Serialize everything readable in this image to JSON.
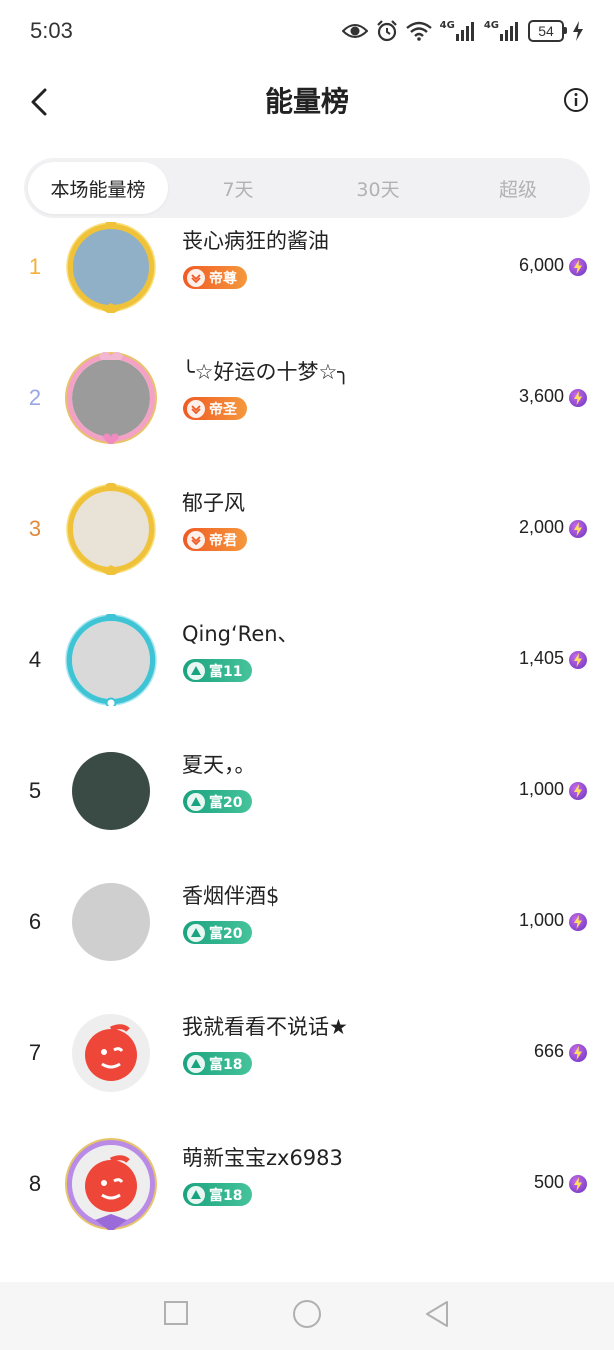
{
  "status_bar": {
    "time": "5:03",
    "battery": "54",
    "net1": "4G",
    "net2": "4G"
  },
  "header": {
    "title": "能量榜"
  },
  "tabs": [
    "本场能量榜",
    "7天",
    "30天",
    "超级"
  ],
  "ranking": [
    {
      "rank": "1",
      "rank_color": "#f3b13a",
      "name": "丧心病狂的酱油",
      "badge": "帝尊",
      "badge_type": "orange",
      "score": "6,000",
      "avatar_bg": "#8fb0c6",
      "frame": "gold"
    },
    {
      "rank": "2",
      "rank_color": "#9aa6e8",
      "name": "╰☆好运の十梦☆╮",
      "badge": "帝圣",
      "badge_type": "orange",
      "score": "3,600",
      "avatar_bg": "#9b9b9b",
      "frame": "pink"
    },
    {
      "rank": "3",
      "rank_color": "#e08a3a",
      "name": "郁子风",
      "badge": "帝君",
      "badge_type": "orange",
      "score": "2,000",
      "avatar_bg": "#e9e2d6",
      "frame": "gold"
    },
    {
      "rank": "4",
      "rank_color": "#222222",
      "name": "Qing‘Ren、",
      "badge": "富11",
      "badge_type": "green",
      "score": "1,405",
      "avatar_bg": "#d9d9d9",
      "frame": "cyan"
    },
    {
      "rank": "5",
      "rank_color": "#222222",
      "name": "夏天，。",
      "badge": "富20",
      "badge_type": "green",
      "score": "1,000",
      "avatar_bg": "#3a4a44",
      "frame": "none"
    },
    {
      "rank": "6",
      "rank_color": "#222222",
      "name": "香烟伴酒$",
      "badge": "富20",
      "badge_type": "green",
      "score": "1,000",
      "avatar_bg": "#cfcfcf",
      "frame": "none"
    },
    {
      "rank": "7",
      "rank_color": "#222222",
      "name": "我就看看不说话★",
      "badge": "富18",
      "badge_type": "green",
      "score": "666",
      "avatar_bg": "#eeeeee",
      "frame": "none"
    },
    {
      "rank": "8",
      "rank_color": "#222222",
      "name": "萌新宝宝zx6983",
      "badge": "富18",
      "badge_type": "green",
      "score": "500",
      "avatar_bg": "#eeeeee",
      "frame": "purple"
    }
  ]
}
